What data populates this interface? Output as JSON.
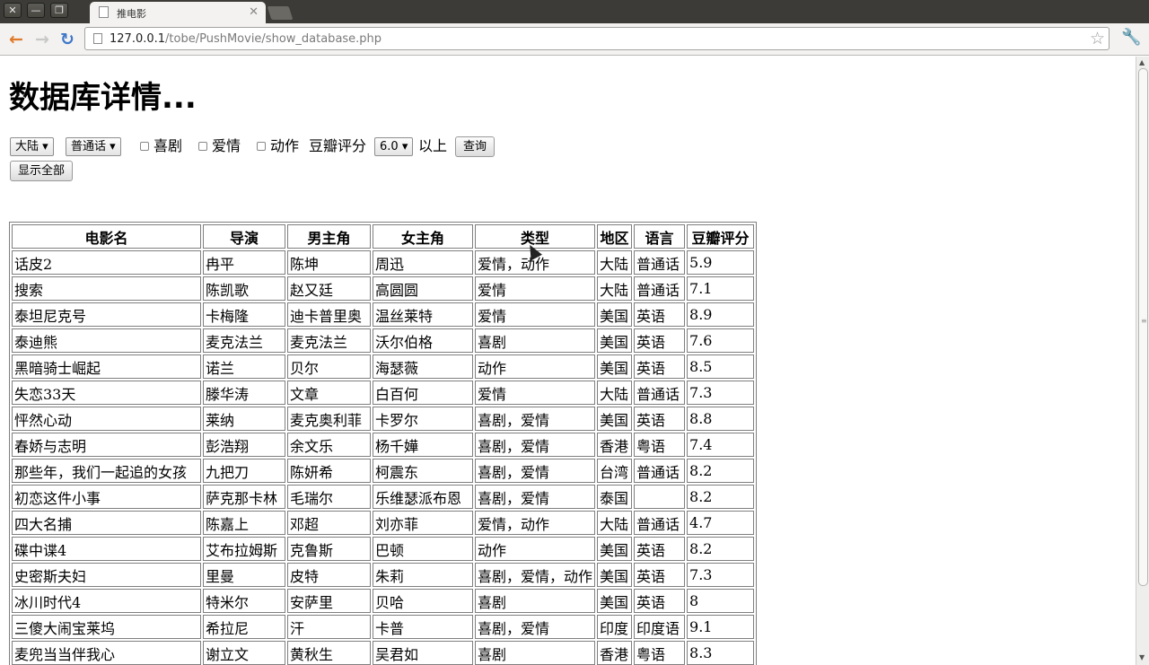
{
  "browser": {
    "tab_title": "推电影",
    "url_host": "127.0.0.1",
    "url_path": "/tobe/PushMovie/show_database.php"
  },
  "page": {
    "title": "数据库详情..."
  },
  "filters": {
    "region_selected": "大陆",
    "language_selected": "普通话",
    "genre_comedy": "喜剧",
    "genre_romance": "爱情",
    "genre_action": "动作",
    "rating_label": "豆瓣评分",
    "rating_selected": "6.0",
    "rating_suffix": "以上",
    "query_button": "查询",
    "show_all_button": "显示全部"
  },
  "table": {
    "headers": [
      "电影名",
      "导演",
      "男主角",
      "女主角",
      "类型",
      "地区",
      "语言",
      "豆瓣评分"
    ],
    "rows": [
      [
        "话皮2",
        "冉平",
        "陈坤",
        "周迅",
        "爱情，动作",
        "大陆",
        "普通话",
        "5.9"
      ],
      [
        "搜索",
        "陈凯歌",
        "赵又廷",
        "高圆圆",
        "爱情",
        "大陆",
        "普通话",
        "7.1"
      ],
      [
        "泰坦尼克号",
        "卡梅隆",
        "迪卡普里奥",
        "温丝莱特",
        "爱情",
        "美国",
        "英语",
        "8.9"
      ],
      [
        "泰迪熊",
        "麦克法兰",
        "麦克法兰",
        "沃尔伯格",
        "喜剧",
        "美国",
        "英语",
        "7.6"
      ],
      [
        "黑暗骑士崛起",
        "诺兰",
        "贝尔",
        "海瑟薇",
        "动作",
        "美国",
        "英语",
        "8.5"
      ],
      [
        "失恋33天",
        "滕华涛",
        "文章",
        "白百何",
        "爱情",
        "大陆",
        "普通话",
        "7.3"
      ],
      [
        "怦然心动",
        "莱纳",
        "麦克奥利菲",
        "卡罗尔",
        "喜剧，爱情",
        "美国",
        "英语",
        "8.8"
      ],
      [
        "春娇与志明",
        "彭浩翔",
        "余文乐",
        "杨千嬅",
        "喜剧，爱情",
        "香港",
        "粤语",
        "7.4"
      ],
      [
        "那些年，我们一起追的女孩",
        "九把刀",
        "陈妍希",
        "柯震东",
        "喜剧，爱情",
        "台湾",
        "普通话",
        "8.2"
      ],
      [
        "初恋这件小事",
        "萨克那卡林",
        "毛瑞尔",
        "乐维瑟派布恩",
        "喜剧，爱情",
        "泰国",
        "",
        "8.2"
      ],
      [
        "四大名捕",
        "陈嘉上",
        "邓超",
        "刘亦菲",
        "爱情，动作",
        "大陆",
        "普通话",
        "4.7"
      ],
      [
        "碟中谍4",
        "艾布拉姆斯",
        "克鲁斯",
        "巴顿",
        "动作",
        "美国",
        "英语",
        "8.2"
      ],
      [
        "史密斯夫妇",
        "里曼",
        "皮特",
        "朱莉",
        "喜剧，爱情，动作",
        "美国",
        "英语",
        "7.3"
      ],
      [
        "冰川时代4",
        "特米尔",
        "安萨里",
        "贝哈",
        "喜剧",
        "美国",
        "英语",
        "8"
      ],
      [
        "三傻大闹宝莱坞",
        "希拉尼",
        "汗",
        "卡普",
        "喜剧，爱情",
        "印度",
        "印度语",
        "9.1"
      ],
      [
        "麦兜当当伴我心",
        "谢立文",
        "黄秋生",
        "吴君如",
        "喜剧",
        "香港",
        "粤语",
        "8.3"
      ]
    ]
  }
}
